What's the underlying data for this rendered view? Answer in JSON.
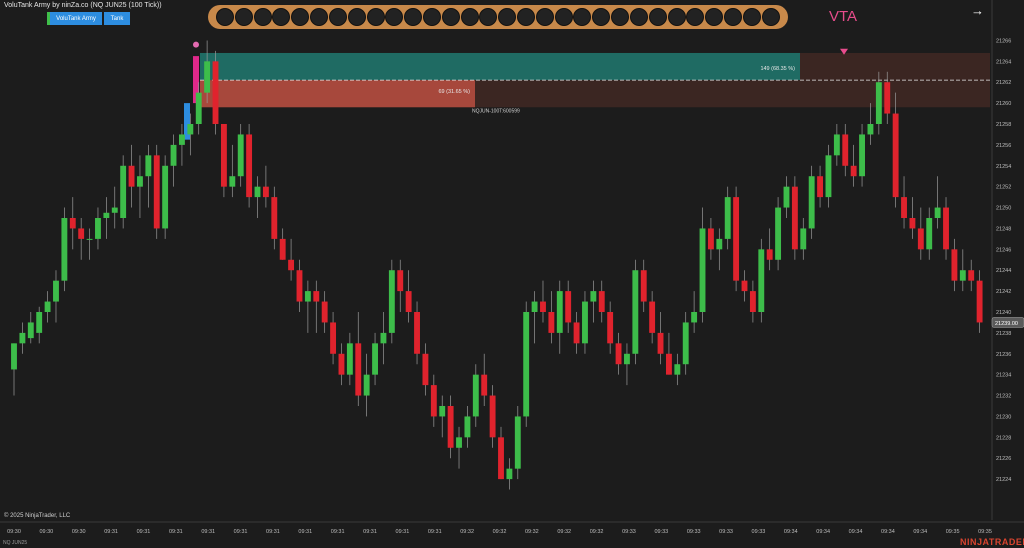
{
  "header": {
    "title": "VoluTank Army by ninZa.co (NQ JUN25 (100 Tick))",
    "buttons": [
      "VoluTank Army",
      "Tank"
    ]
  },
  "footer": {
    "copyright": "© 2025 NinjaTrader, LLC",
    "symbol": "NQ JUN25",
    "brand": "NINJATRADER"
  },
  "annotation": {
    "vta": "VTA",
    "nav": "→"
  },
  "dot_count": 30,
  "zones": {
    "buy_label": "149 (68.35 %)",
    "sell_label": "69 (31.65 %)",
    "bar_label": "NQJUN-100T:600599",
    "buy_color": "#1f6b63",
    "sell_color": "#a7483c"
  },
  "colors": {
    "up": "#3dbd4a",
    "down": "#e0232d",
    "price_tag": "#5a5a5a"
  },
  "chart_data": {
    "type": "candlestick",
    "ylim": [
      21222,
      21267
    ],
    "y_ticks": [
      21224,
      21226,
      21228,
      21230,
      21232,
      21234,
      21236,
      21238,
      21240,
      21242,
      21244,
      21246,
      21248,
      21250,
      21252,
      21254,
      21256,
      21258,
      21260,
      21262,
      21264,
      21266
    ],
    "current_price": "21239.00",
    "x_labels": [
      "09:30",
      "09:30",
      "09:30",
      "09:31",
      "09:31",
      "09:31",
      "09:31",
      "09:31",
      "09:31",
      "09:31",
      "09:31",
      "09:31",
      "09:31",
      "09:31",
      "09:32",
      "09:32",
      "09:32",
      "09:32",
      "09:32",
      "09:33",
      "09:33",
      "09:33",
      "09:33",
      "09:33",
      "09:34",
      "09:34",
      "09:34",
      "09:34",
      "09:34",
      "09:35",
      "09:35"
    ],
    "candles": [
      {
        "o": 21234.5,
        "h": 21237,
        "l": 21232,
        "c": 21237
      },
      {
        "o": 21237,
        "h": 21239,
        "l": 21236,
        "c": 21238
      },
      {
        "o": 21237.5,
        "h": 21240,
        "l": 21237,
        "c": 21239
      },
      {
        "o": 21238,
        "h": 21240.5,
        "l": 21237,
        "c": 21240
      },
      {
        "o": 21240,
        "h": 21242,
        "l": 21239,
        "c": 21241
      },
      {
        "o": 21241,
        "h": 21244,
        "l": 21239,
        "c": 21243
      },
      {
        "o": 21243,
        "h": 21250,
        "l": 21242,
        "c": 21249
      },
      {
        "o": 21249,
        "h": 21251,
        "l": 21246,
        "c": 21248
      },
      {
        "o": 21248,
        "h": 21249,
        "l": 21245,
        "c": 21247
      },
      {
        "o": 21247,
        "h": 21248,
        "l": 21245,
        "c": 21247
      },
      {
        "o": 21247,
        "h": 21250,
        "l": 21246,
        "c": 21249
      },
      {
        "o": 21249,
        "h": 21251,
        "l": 21247,
        "c": 21249.5
      },
      {
        "o": 21249.5,
        "h": 21252,
        "l": 21248,
        "c": 21250
      },
      {
        "o": 21249,
        "h": 21255,
        "l": 21248,
        "c": 21254
      },
      {
        "o": 21254,
        "h": 21256,
        "l": 21250,
        "c": 21252
      },
      {
        "o": 21252,
        "h": 21255,
        "l": 21249,
        "c": 21253
      },
      {
        "o": 21253,
        "h": 21256,
        "l": 21250,
        "c": 21255
      },
      {
        "o": 21255,
        "h": 21256,
        "l": 21247,
        "c": 21248
      },
      {
        "o": 21248,
        "h": 21255,
        "l": 21247,
        "c": 21254
      },
      {
        "o": 21254,
        "h": 21257,
        "l": 21252,
        "c": 21256
      },
      {
        "o": 21256,
        "h": 21258,
        "l": 21254,
        "c": 21257
      },
      {
        "o": 21257,
        "h": 21259,
        "l": 21255,
        "c": 21258
      },
      {
        "o": 21258,
        "h": 21262,
        "l": 21257,
        "c": 21261
      },
      {
        "o": 21261,
        "h": 21266,
        "l": 21260,
        "c": 21264
      },
      {
        "o": 21264,
        "h": 21265,
        "l": 21257,
        "c": 21258
      },
      {
        "o": 21258,
        "h": 21258,
        "l": 21251,
        "c": 21252
      },
      {
        "o": 21252,
        "h": 21256,
        "l": 21251,
        "c": 21253
      },
      {
        "o": 21253,
        "h": 21258,
        "l": 21252,
        "c": 21257
      },
      {
        "o": 21257,
        "h": 21258,
        "l": 21250,
        "c": 21251
      },
      {
        "o": 21251,
        "h": 21253,
        "l": 21249,
        "c": 21252
      },
      {
        "o": 21252,
        "h": 21254,
        "l": 21250,
        "c": 21251
      },
      {
        "o": 21251,
        "h": 21252,
        "l": 21246,
        "c": 21247
      },
      {
        "o": 21247,
        "h": 21248,
        "l": 21245,
        "c": 21245
      },
      {
        "o": 21245,
        "h": 21247,
        "l": 21243,
        "c": 21244
      },
      {
        "o": 21244,
        "h": 21245,
        "l": 21240,
        "c": 21241
      },
      {
        "o": 21241,
        "h": 21243,
        "l": 21238,
        "c": 21242
      },
      {
        "o": 21242,
        "h": 21243,
        "l": 21238,
        "c": 21241
      },
      {
        "o": 21241,
        "h": 21242,
        "l": 21238,
        "c": 21239
      },
      {
        "o": 21239,
        "h": 21240,
        "l": 21235,
        "c": 21236
      },
      {
        "o": 21236,
        "h": 21237,
        "l": 21233,
        "c": 21234
      },
      {
        "o": 21234,
        "h": 21238,
        "l": 21233,
        "c": 21237
      },
      {
        "o": 21237,
        "h": 21240,
        "l": 21231,
        "c": 21232
      },
      {
        "o": 21232,
        "h": 21236,
        "l": 21230,
        "c": 21234
      },
      {
        "o": 21234,
        "h": 21238,
        "l": 21233,
        "c": 21237
      },
      {
        "o": 21237,
        "h": 21240,
        "l": 21235,
        "c": 21238
      },
      {
        "o": 21238,
        "h": 21245,
        "l": 21237,
        "c": 21244
      },
      {
        "o": 21244,
        "h": 21245,
        "l": 21240,
        "c": 21242
      },
      {
        "o": 21242,
        "h": 21244,
        "l": 21239,
        "c": 21240
      },
      {
        "o": 21240,
        "h": 21241,
        "l": 21235,
        "c": 21236
      },
      {
        "o": 21236,
        "h": 21237,
        "l": 21232,
        "c": 21233
      },
      {
        "o": 21233,
        "h": 21234,
        "l": 21229,
        "c": 21230
      },
      {
        "o": 21230,
        "h": 21232,
        "l": 21228,
        "c": 21231
      },
      {
        "o": 21231,
        "h": 21232,
        "l": 21226,
        "c": 21227
      },
      {
        "o": 21227,
        "h": 21229,
        "l": 21225,
        "c": 21228
      },
      {
        "o": 21228,
        "h": 21231,
        "l": 21227,
        "c": 21230
      },
      {
        "o": 21230,
        "h": 21235,
        "l": 21229,
        "c": 21234
      },
      {
        "o": 21234,
        "h": 21236,
        "l": 21231,
        "c": 21232
      },
      {
        "o": 21232,
        "h": 21233,
        "l": 21227,
        "c": 21228
      },
      {
        "o": 21228,
        "h": 21229,
        "l": 21224,
        "c": 21224
      },
      {
        "o": 21224,
        "h": 21226,
        "l": 21223,
        "c": 21225
      },
      {
        "o": 21225,
        "h": 21231,
        "l": 21224,
        "c": 21230
      },
      {
        "o": 21230,
        "h": 21241,
        "l": 21229,
        "c": 21240
      },
      {
        "o": 21240,
        "h": 21242,
        "l": 21237,
        "c": 21241
      },
      {
        "o": 21241,
        "h": 21243,
        "l": 21239,
        "c": 21240
      },
      {
        "o": 21240,
        "h": 21242,
        "l": 21237,
        "c": 21238
      },
      {
        "o": 21238,
        "h": 21243,
        "l": 21236,
        "c": 21242
      },
      {
        "o": 21242,
        "h": 21243,
        "l": 21238,
        "c": 21239
      },
      {
        "o": 21239,
        "h": 21240,
        "l": 21236,
        "c": 21237
      },
      {
        "o": 21237,
        "h": 21242,
        "l": 21236,
        "c": 21241
      },
      {
        "o": 21241,
        "h": 21243,
        "l": 21239,
        "c": 21242
      },
      {
        "o": 21242,
        "h": 21243,
        "l": 21239,
        "c": 21240
      },
      {
        "o": 21240,
        "h": 21241,
        "l": 21236,
        "c": 21237
      },
      {
        "o": 21237,
        "h": 21238,
        "l": 21234,
        "c": 21235
      },
      {
        "o": 21235,
        "h": 21237,
        "l": 21233,
        "c": 21236
      },
      {
        "o": 21236,
        "h": 21245,
        "l": 21235,
        "c": 21244
      },
      {
        "o": 21244,
        "h": 21245,
        "l": 21240,
        "c": 21241
      },
      {
        "o": 21241,
        "h": 21242,
        "l": 21237,
        "c": 21238
      },
      {
        "o": 21238,
        "h": 21240,
        "l": 21235,
        "c": 21236
      },
      {
        "o": 21236,
        "h": 21238,
        "l": 21234,
        "c": 21234
      },
      {
        "o": 21234,
        "h": 21236,
        "l": 21233,
        "c": 21235
      },
      {
        "o": 21235,
        "h": 21240,
        "l": 21234,
        "c": 21239
      },
      {
        "o": 21239,
        "h": 21242,
        "l": 21238,
        "c": 21240
      },
      {
        "o": 21240,
        "h": 21250,
        "l": 21239,
        "c": 21248
      },
      {
        "o": 21248,
        "h": 21249,
        "l": 21245,
        "c": 21246
      },
      {
        "o": 21246,
        "h": 21248,
        "l": 21244,
        "c": 21247
      },
      {
        "o": 21247,
        "h": 21252,
        "l": 21246,
        "c": 21251
      },
      {
        "o": 21251,
        "h": 21252,
        "l": 21242,
        "c": 21243
      },
      {
        "o": 21243,
        "h": 21244,
        "l": 21241,
        "c": 21242
      },
      {
        "o": 21242,
        "h": 21243,
        "l": 21239,
        "c": 21240
      },
      {
        "o": 21240,
        "h": 21247,
        "l": 21239,
        "c": 21246
      },
      {
        "o": 21246,
        "h": 21248,
        "l": 21244,
        "c": 21245
      },
      {
        "o": 21245,
        "h": 21251,
        "l": 21244,
        "c": 21250
      },
      {
        "o": 21250,
        "h": 21253,
        "l": 21249,
        "c": 21252
      },
      {
        "o": 21252,
        "h": 21253,
        "l": 21245,
        "c": 21246
      },
      {
        "o": 21246,
        "h": 21249,
        "l": 21245,
        "c": 21248
      },
      {
        "o": 21248,
        "h": 21254,
        "l": 21247,
        "c": 21253
      },
      {
        "o": 21253,
        "h": 21254,
        "l": 21250,
        "c": 21251
      },
      {
        "o": 21251,
        "h": 21256,
        "l": 21250,
        "c": 21255
      },
      {
        "o": 21255,
        "h": 21258,
        "l": 21254,
        "c": 21257
      },
      {
        "o": 21257,
        "h": 21258,
        "l": 21253,
        "c": 21254
      },
      {
        "o": 21254,
        "h": 21256,
        "l": 21252,
        "c": 21253
      },
      {
        "o": 21253,
        "h": 21258,
        "l": 21252,
        "c": 21257
      },
      {
        "o": 21257,
        "h": 21260,
        "l": 21256,
        "c": 21258
      },
      {
        "o": 21258,
        "h": 21263,
        "l": 21257,
        "c": 21262
      },
      {
        "o": 21262,
        "h": 21263,
        "l": 21258,
        "c": 21259
      },
      {
        "o": 21259,
        "h": 21261,
        "l": 21250,
        "c": 21251
      },
      {
        "o": 21251,
        "h": 21253,
        "l": 21248,
        "c": 21249
      },
      {
        "o": 21249,
        "h": 21251,
        "l": 21247,
        "c": 21248
      },
      {
        "o": 21248,
        "h": 21250,
        "l": 21245,
        "c": 21246
      },
      {
        "o": 21246,
        "h": 21250,
        "l": 21245,
        "c": 21249
      },
      {
        "o": 21249,
        "h": 21253,
        "l": 21248,
        "c": 21250
      },
      {
        "o": 21250,
        "h": 21251,
        "l": 21245,
        "c": 21246
      },
      {
        "o": 21246,
        "h": 21247,
        "l": 21242,
        "c": 21243
      },
      {
        "o": 21243,
        "h": 21246,
        "l": 21242,
        "c": 21244
      },
      {
        "o": 21244,
        "h": 21245,
        "l": 21242,
        "c": 21243
      },
      {
        "o": 21243,
        "h": 21244,
        "l": 21238,
        "c": 21239
      }
    ]
  }
}
